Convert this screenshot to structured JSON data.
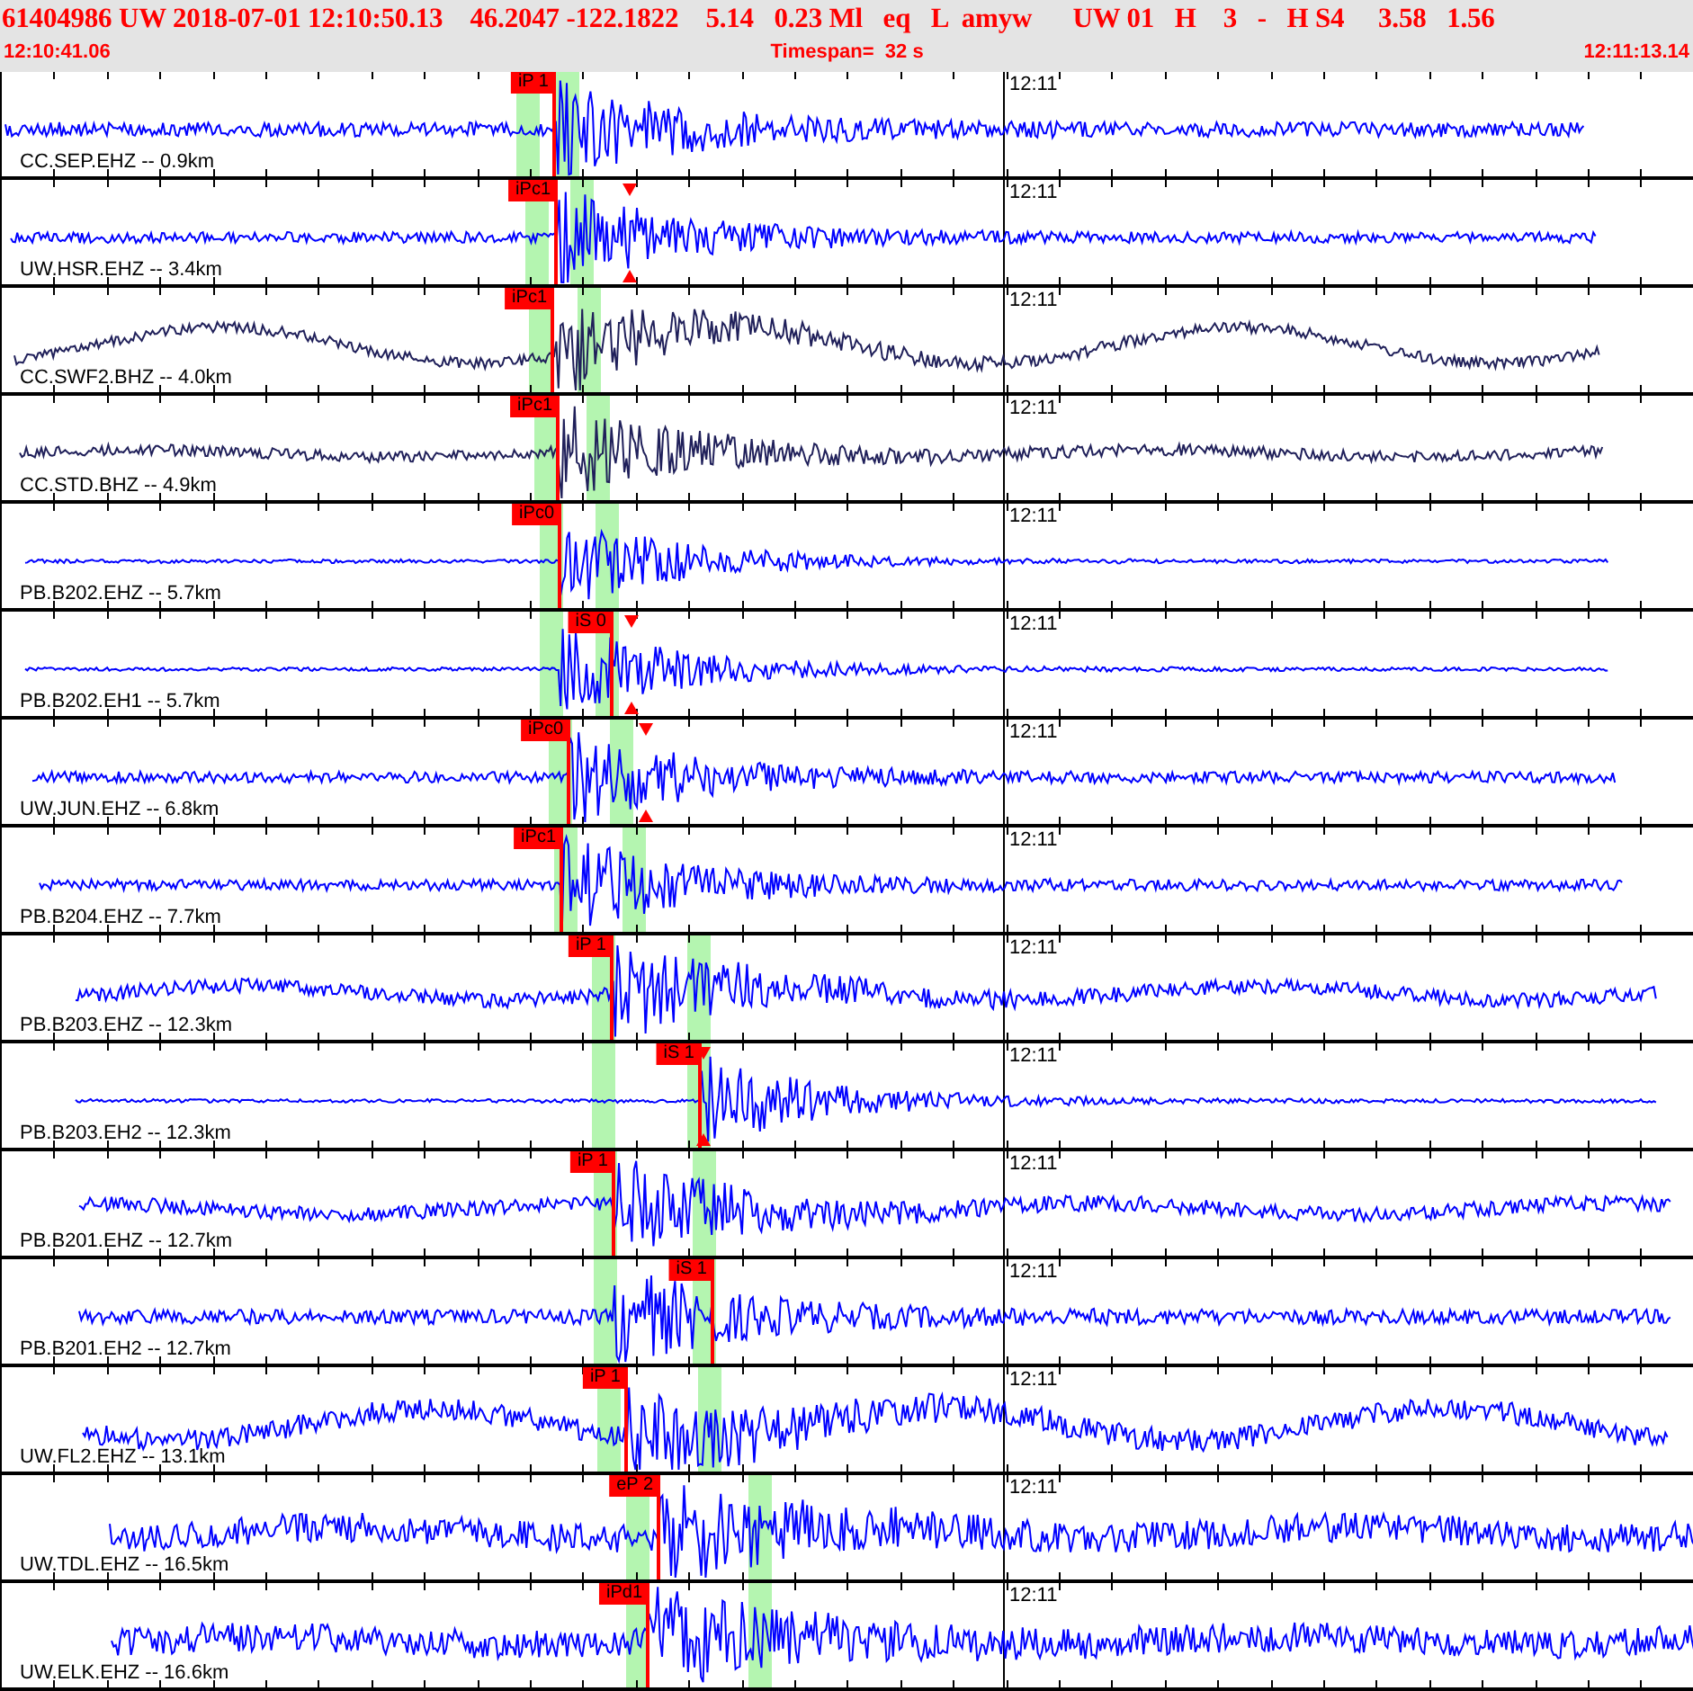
{
  "header": {
    "summary": "61404986 UW 2018-07-01 12:10:50.13    46.2047 -122.1822    5.14   0.23 Ml   eq   L  amyw      UW 01   H    3   -   H S4     3.58   1.56",
    "start_time": "12:10:41.06",
    "timespan": "Timespan=  32 s",
    "end_time": "12:11:13.14"
  },
  "traces": [
    {
      "label": "CC.SEP.EHZ -- 0.9km",
      "pick": "iP 1",
      "minute": "12:11",
      "color": "#0000ff"
    },
    {
      "label": "UW.HSR.EHZ -- 3.4km",
      "pick": "iPc1",
      "minute": "12:11",
      "color": "#0000ff"
    },
    {
      "label": "CC.SWF2.BHZ -- 4.0km",
      "pick": "iPc1",
      "minute": "12:11",
      "color": "#20205a"
    },
    {
      "label": "CC.STD.BHZ -- 4.9km",
      "pick": "iPc1",
      "minute": "12:11",
      "color": "#20205a"
    },
    {
      "label": "PB.B202.EHZ -- 5.7km",
      "pick": "iPc0",
      "minute": "12:11",
      "color": "#0000ff"
    },
    {
      "label": "PB.B202.EH1 -- 5.7km",
      "pick": "iS 0",
      "minute": "12:11",
      "color": "#0000ff"
    },
    {
      "label": "UW.JUN.EHZ -- 6.8km",
      "pick": "iPc0",
      "minute": "12:11",
      "color": "#0000ff"
    },
    {
      "label": "PB.B204.EHZ -- 7.7km",
      "pick": "iPc1",
      "minute": "12:11",
      "color": "#0000ff"
    },
    {
      "label": "PB.B203.EHZ -- 12.3km",
      "pick": "iP 1",
      "minute": "12:11",
      "color": "#0000ff"
    },
    {
      "label": "PB.B203.EH2 -- 12.3km",
      "pick": "iS 1",
      "minute": "12:11",
      "color": "#0000ff"
    },
    {
      "label": "PB.B201.EHZ -- 12.7km",
      "pick": "iP 1",
      "minute": "12:11",
      "color": "#0000ff"
    },
    {
      "label": "PB.B201.EH2 -- 12.7km",
      "pick": "iS 1",
      "minute": "12:11",
      "color": "#0000ff"
    },
    {
      "label": "UW.FL2.EHZ -- 13.1km",
      "pick": "iP 1",
      "minute": "12:11",
      "color": "#0000ff"
    },
    {
      "label": "UW.TDL.EHZ -- 16.5km",
      "pick": "eP 2",
      "minute": "12:11",
      "color": "#0000ff"
    },
    {
      "label": "UW.ELK.EHZ -- 16.6km",
      "pick": "iPd1",
      "minute": "12:11",
      "color": "#0000ff"
    }
  ]
}
